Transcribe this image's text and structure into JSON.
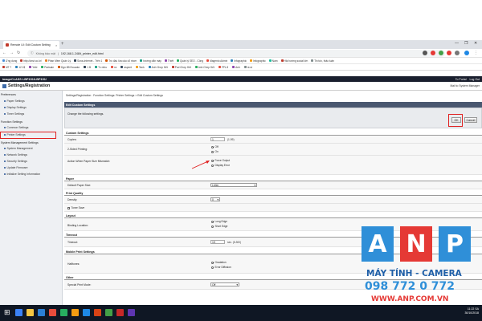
{
  "browser": {
    "tab_title": "Remote UI: Edit Custom Setting",
    "tab_close": "×",
    "new_tab": "+",
    "security_label": "Không bảo mật",
    "url": "192.168.1.248/t_printer_edit.html",
    "bookmarks_row1": [
      {
        "label": "Ứng dụng",
        "color": "#4a90d9"
      },
      {
        "label": "http://anvi.co.kr/",
        "color": "#c0392b"
      },
      {
        "label": "Phần Mềm Quản Lý",
        "color": "#e67e22"
      },
      {
        "label": "Sona-Internet - Trên 1",
        "color": "#2c3e50"
      },
      {
        "label": "Trò đấu lừa câu cổ nhơn",
        "color": "#d35400"
      },
      {
        "label": "hướng dẫn máy",
        "color": "#16a085"
      },
      {
        "label": "Thiết",
        "color": "#8e44ad"
      },
      {
        "label": "Quản lý SEO - Công",
        "color": "#27ae60"
      },
      {
        "label": "Magento Admin",
        "color": "#e74c3c"
      },
      {
        "label": "Infographic",
        "color": "#2980b9"
      },
      {
        "label": "Infographic",
        "color": "#f39c12"
      },
      {
        "label": "Nam",
        "color": "#1abc9c"
      },
      {
        "label": "Hải hướng social lớn",
        "color": "#c0392b"
      },
      {
        "label": "Tin tức, thảo luận",
        "color": "#7f8c8d"
      }
    ],
    "bookmarks_row2": [
      {
        "label": "MT 7",
        "color": "#c0392b"
      },
      {
        "label": "12 1$",
        "color": "#2980b9"
      },
      {
        "label": "Yebi",
        "color": "#8e44ad"
      },
      {
        "label": "Partsale",
        "color": "#27ae60"
      },
      {
        "label": "Dgn.B5 Ecuador",
        "color": "#d35400"
      },
      {
        "label": "1 B",
        "color": "#2c3e50"
      },
      {
        "label": "Tv rebu",
        "color": "#16a085"
      },
      {
        "label": "nx",
        "color": "#e74c3c"
      },
      {
        "label": "aspnet",
        "color": "#34495e"
      },
      {
        "label": "Tank",
        "color": "#f39c12"
      },
      {
        "label": "Anh Chúp Hết",
        "color": "#2980b9"
      },
      {
        "label": "Pod Chúp Hết",
        "color": "#c0392b"
      },
      {
        "label": "Anh Chúp Hết",
        "color": "#27ae60"
      },
      {
        "label": "FPL 8",
        "color": "#e74c3c"
      },
      {
        "label": "Anh",
        "color": "#8e44ad"
      },
      {
        "label": "ni-st",
        "color": "#7f8c8d"
      }
    ]
  },
  "printer": {
    "device": "imageCLASS LBP151/LBP151/",
    "to_portal": "To Portal",
    "logout": "Log Out",
    "page_title": "Settings/Registration",
    "mail_to_admin": "Mail to System Manager"
  },
  "nav": {
    "preferences": "Preferences",
    "preferences_items": [
      "Paper Settings",
      "Display Settings",
      "Timer Settings"
    ],
    "function_settings": "Function Settings",
    "function_items": [
      "Common Settings",
      "Printer Settings"
    ],
    "system_management": "System Management Settings",
    "system_items": [
      "System Management",
      "Network Settings",
      "Security Settings",
      "Update Firmware",
      "Initialize Setting Information"
    ]
  },
  "content": {
    "breadcrumb": "Settings/Registration : Function Settings: Printer Settings > Edit Custom Settings",
    "section_title": "Edit Custom Settings",
    "change_text": "Change the following settings.",
    "ok": "OK",
    "cancel": "Cancel",
    "custom_settings": "Custom Settings",
    "copies_label": "Copies:",
    "copies_value": "1",
    "copies_range": "(1-99)",
    "twosided_label": "2-Sided Printing:",
    "twosided_options": [
      "Off",
      "On"
    ],
    "twosided_selected": 0,
    "mismatch_label": "Action When Paper Size Mismatch:",
    "mismatch_options": [
      "Force Output",
      "Display Error"
    ],
    "mismatch_selected": 0,
    "paper_header": "Paper",
    "default_paper_label": "Default Paper Size:",
    "default_paper_value": "Letter",
    "quality_header": "Print Quality",
    "density_label": "Density:",
    "density_value": "0",
    "toner_save_label": "Toner Save",
    "layout_header": "Layout",
    "binding_label": "Binding Location:",
    "binding_options": [
      "Long Edge",
      "Short Edge"
    ],
    "binding_selected": 0,
    "timeout_header": "Timeout",
    "timeout_label": "Timeout:",
    "timeout_value": "15",
    "timeout_range": "sec. (5-300)",
    "mobile_header": "Mobile Print Settings",
    "halftones_label": "Halftones:",
    "halftones_options": [
      "Gradation",
      "Error Diffusion"
    ],
    "halftones_selected": 0,
    "other_header": "Other",
    "special_label": "Special Print Mode:",
    "special_value": "Off"
  },
  "taskbar": {
    "time": "11:22 SA",
    "date": "30/10/2018",
    "icon_colors": [
      "#ffffff",
      "#3b82f6",
      "#f5c542",
      "#2b7fd4",
      "#e74c3c",
      "#27ae60",
      "#f39c12",
      "#1e88e5",
      "#d84315",
      "#43a047",
      "#c62828",
      "#5e35b1"
    ]
  },
  "watermark": {
    "letters": [
      "A",
      "N",
      "P"
    ],
    "letter_colors": [
      "#2f8fd8",
      "#e53935",
      "#2f8fd8"
    ],
    "line1": "MÁY TÍNH - CAMERA",
    "line2": "098 772 0 772",
    "line3": "WWW.ANP.COM.VN"
  }
}
